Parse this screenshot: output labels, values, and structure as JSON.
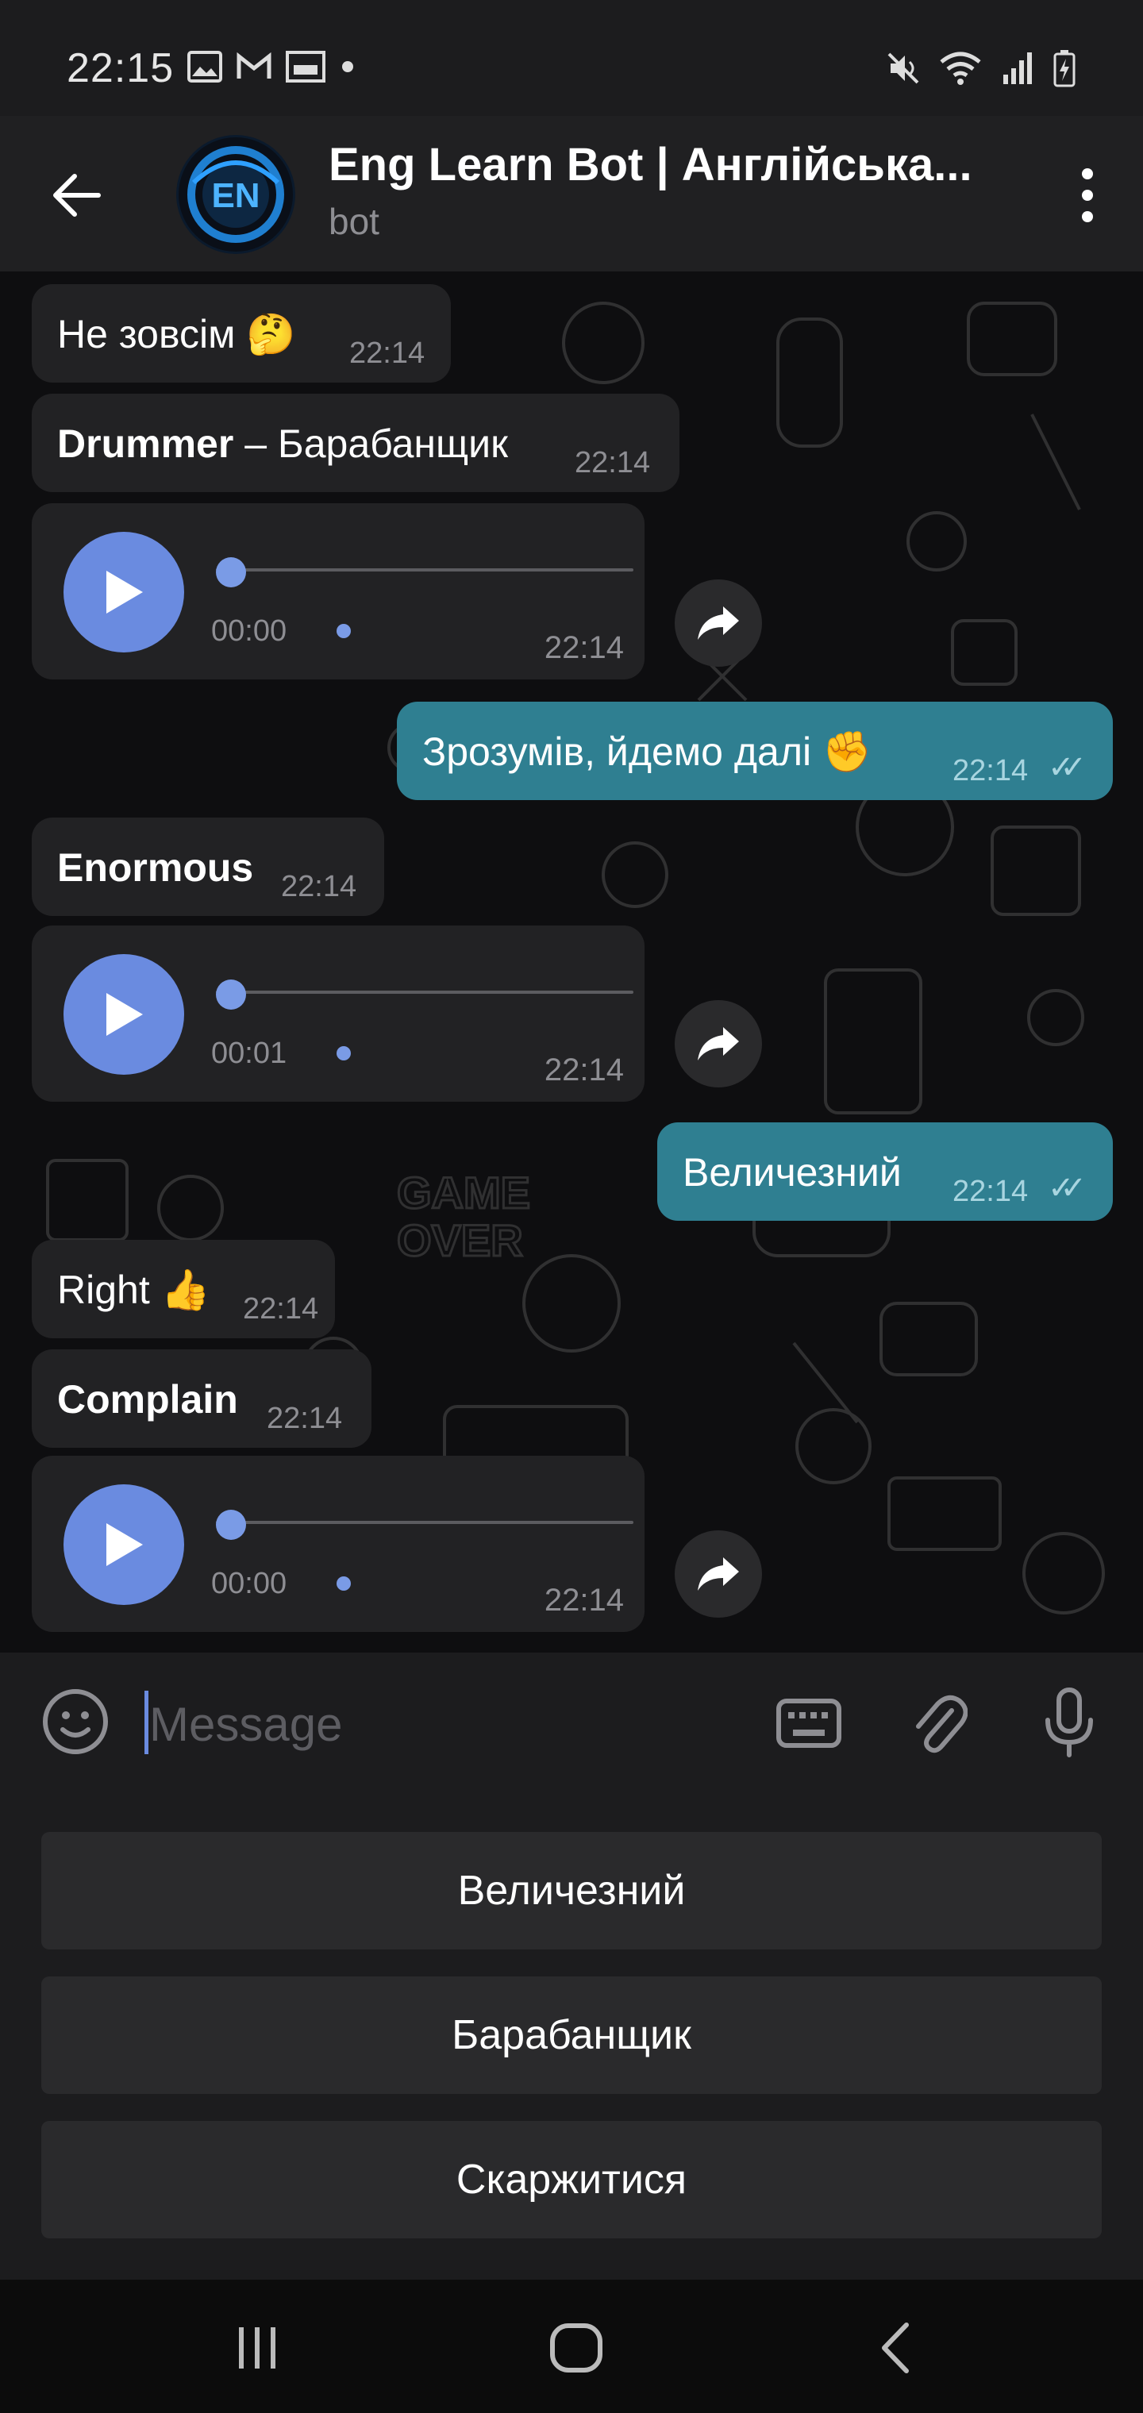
{
  "status_bar": {
    "time": "22:15",
    "icons_left": [
      "gallery-icon",
      "gmail-icon",
      "cast-icon",
      "dot-icon"
    ],
    "icons_right": [
      "mute-icon",
      "wifi-icon",
      "signal-icon",
      "battery-charging-icon"
    ]
  },
  "header": {
    "title": "Eng Learn Bot | Англійська...",
    "subtitle": "bot",
    "avatar_text": "EN"
  },
  "messages": [
    {
      "type": "text",
      "dir": "in",
      "text": "Не зовсім 🤔",
      "time": "22:14"
    },
    {
      "type": "text",
      "dir": "in",
      "bold": "Drummer",
      "text": " – Барабанщик",
      "time": "22:14"
    },
    {
      "type": "voice",
      "dir": "in",
      "duration": "00:00",
      "time": "22:14"
    },
    {
      "type": "text",
      "dir": "out",
      "text": "Зрозумів, йдемо далі ✊",
      "time": "22:14",
      "status": "✓✓"
    },
    {
      "type": "text",
      "dir": "in",
      "bold": "Enormous",
      "time": "22:14"
    },
    {
      "type": "voice",
      "dir": "in",
      "duration": "00:01",
      "time": "22:14"
    },
    {
      "type": "text",
      "dir": "out",
      "text": "Величезний",
      "time": "22:14",
      "status": "✓✓"
    },
    {
      "type": "text",
      "dir": "in",
      "text": "Right 👍",
      "time": "22:14"
    },
    {
      "type": "text",
      "dir": "in",
      "bold": "Complain",
      "time": "22:14"
    },
    {
      "type": "voice",
      "dir": "in",
      "duration": "00:00",
      "time": "22:14"
    }
  ],
  "composer": {
    "placeholder": "Message"
  },
  "reply_keyboard": {
    "buttons": [
      "Величезний",
      "Барабанщик",
      "Скаржитися"
    ]
  },
  "colors": {
    "accent": "#6a8be0",
    "out_bubble": "#2f7f91",
    "in_bubble": "#222224"
  }
}
